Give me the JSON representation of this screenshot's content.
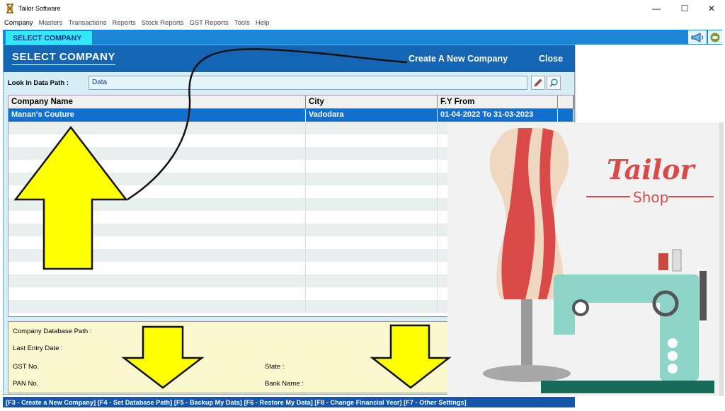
{
  "window": {
    "title": "Tailor Software",
    "minimize": "—",
    "maximize": "☐",
    "close": "✕"
  },
  "menu": [
    "Company",
    "Masters",
    "Transactions",
    "Reports",
    "Stock Reports",
    "GST Reports",
    "Tools",
    "Help"
  ],
  "tab": {
    "label": "SELECT COMPANY"
  },
  "panel": {
    "title": "SELECT COMPANY",
    "create_link": "Create A New Company",
    "close_link": "Close",
    "look_in_label": "Look in Data Path :",
    "data_path": "Data"
  },
  "table": {
    "columns": [
      "Company Name",
      "City",
      "F.Y From"
    ],
    "rows": [
      {
        "company": "Manan's Couture",
        "city": "Vadodara",
        "fy": "01-04-2022 To 31-03-2023"
      }
    ]
  },
  "info": {
    "db_path_label": "Company Database Path :",
    "last_entry_label": "Last Entry Date :",
    "gst_label": "GST No.",
    "pan_label": "PAN No.",
    "state_label": "State :",
    "bank_label": "Bank Name :"
  },
  "status_bar": "[F3 - Create a New Company]  [F4 - Set Database Path]  [F5 - Backup My Data]  [F6 - Restore My Data]  [F8 - Change Financial Year]  [F7 - Other Settings]",
  "ad": {
    "brand": "Tailor",
    "sub": "Shop"
  },
  "colors": {
    "header_blue": "#1466b4",
    "selected_row": "#1270d0",
    "tab_cyan": "#30e8f8",
    "arrow_yellow": "#ffff00",
    "info_bg": "#fbf8d0"
  }
}
